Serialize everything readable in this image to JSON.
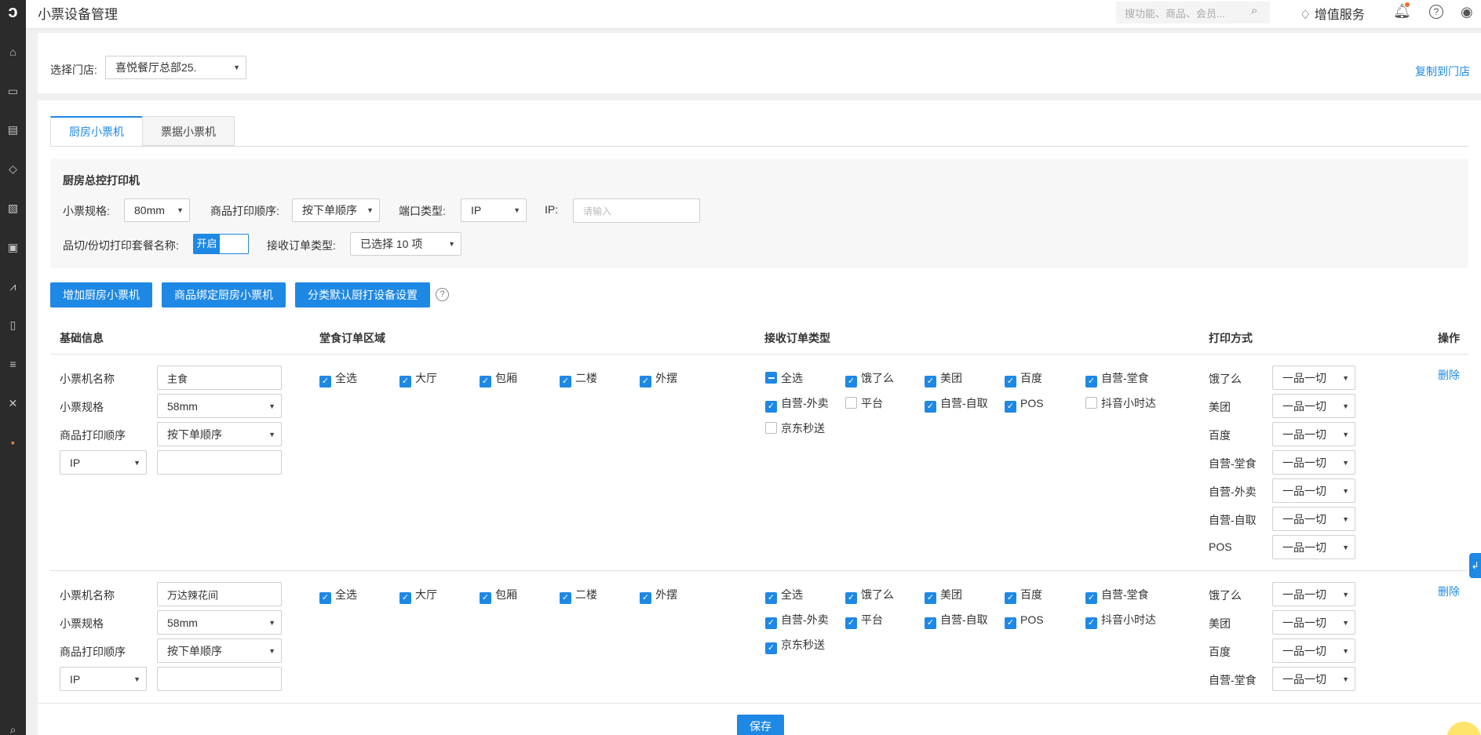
{
  "header": {
    "title": "小票设备管理",
    "search_placeholder": "搜功能、商品、会员...",
    "value_added": "增值服务"
  },
  "store": {
    "label": "选择门店:",
    "value": "喜悦餐厅总部25.",
    "copy_link": "复制到门店"
  },
  "tabs": [
    {
      "label": "厨房小票机",
      "active": true
    },
    {
      "label": "票据小票机",
      "active": false
    }
  ],
  "kitchen_master": {
    "title": "厨房总控打印机",
    "spec_label": "小票规格:",
    "spec_value": "80mm",
    "order_label": "商品打印顺序:",
    "order_value": "按下单顺序",
    "port_label": "端口类型:",
    "port_value": "IP",
    "ip_label": "IP:",
    "ip_placeholder": "请输入",
    "combo_label": "品切/份切打印套餐名称:",
    "combo_toggle": "开启",
    "recv_label": "接收订单类型:",
    "recv_value": "已选择 10 项"
  },
  "buttons": {
    "add": "增加厨房小票机",
    "bind": "商品绑定厨房小票机",
    "category": "分类默认厨打设备设置"
  },
  "table_headers": {
    "basic": "基础信息",
    "dine_area": "堂食订单区域",
    "recv_type": "接收订单类型",
    "print_mode": "打印方式",
    "action": "操作"
  },
  "labels": {
    "name": "小票机名称",
    "spec": "小票规格",
    "order": "商品打印顺序"
  },
  "printers": [
    {
      "name": "主食",
      "spec": "58mm",
      "order": "按下单顺序",
      "port": "IP",
      "ip": "",
      "areas": [
        {
          "label": "全选",
          "state": "checked"
        },
        {
          "label": "大厅",
          "state": "checked"
        },
        {
          "label": "包厢",
          "state": "checked"
        },
        {
          "label": "二楼",
          "state": "checked"
        },
        {
          "label": "外摆",
          "state": "checked"
        }
      ],
      "recv": [
        {
          "label": "全选",
          "state": "indeterminate"
        },
        {
          "label": "饿了么",
          "state": "checked"
        },
        {
          "label": "美团",
          "state": "checked"
        },
        {
          "label": "百度",
          "state": "checked"
        },
        {
          "label": "自营-堂食",
          "state": "checked"
        },
        {
          "label": "自营-外卖",
          "state": "checked"
        },
        {
          "label": "平台",
          "state": "unchecked"
        },
        {
          "label": "自营-自取",
          "state": "checked"
        },
        {
          "label": "POS",
          "state": "checked"
        },
        {
          "label": "抖音小时达",
          "state": "unchecked"
        },
        {
          "label": "京东秒送",
          "state": "unchecked"
        }
      ],
      "modes": [
        {
          "label": "饿了么",
          "value": "一品一切"
        },
        {
          "label": "美团",
          "value": "一品一切"
        },
        {
          "label": "百度",
          "value": "一品一切"
        },
        {
          "label": "自营-堂食",
          "value": "一品一切"
        },
        {
          "label": "自营-外卖",
          "value": "一品一切"
        },
        {
          "label": "自营-自取",
          "value": "一品一切"
        },
        {
          "label": "POS",
          "value": "一品一切"
        }
      ],
      "delete": "删除"
    },
    {
      "name": "万达辣花间",
      "spec": "58mm",
      "order": "按下单顺序",
      "port": "IP",
      "ip": "",
      "areas": [
        {
          "label": "全选",
          "state": "checked"
        },
        {
          "label": "大厅",
          "state": "checked"
        },
        {
          "label": "包厢",
          "state": "checked"
        },
        {
          "label": "二楼",
          "state": "checked"
        },
        {
          "label": "外摆",
          "state": "checked"
        }
      ],
      "recv": [
        {
          "label": "全选",
          "state": "checked"
        },
        {
          "label": "饿了么",
          "state": "checked"
        },
        {
          "label": "美团",
          "state": "checked"
        },
        {
          "label": "百度",
          "state": "checked"
        },
        {
          "label": "自营-堂食",
          "state": "checked"
        },
        {
          "label": "自营-外卖",
          "state": "checked"
        },
        {
          "label": "平台",
          "state": "checked"
        },
        {
          "label": "自营-自取",
          "state": "checked"
        },
        {
          "label": "POS",
          "state": "checked"
        },
        {
          "label": "抖音小时达",
          "state": "checked"
        },
        {
          "label": "京东秒送",
          "state": "checked"
        }
      ],
      "modes": [
        {
          "label": "饿了么",
          "value": "一品一切"
        },
        {
          "label": "美团",
          "value": "一品一切"
        },
        {
          "label": "百度",
          "value": "一品一切"
        },
        {
          "label": "自营-堂食",
          "value": "一品一切"
        }
      ],
      "delete": "删除"
    }
  ],
  "save": "保存",
  "colors": {
    "accent": "#1e88e5",
    "nav": "#2b2b2b"
  }
}
